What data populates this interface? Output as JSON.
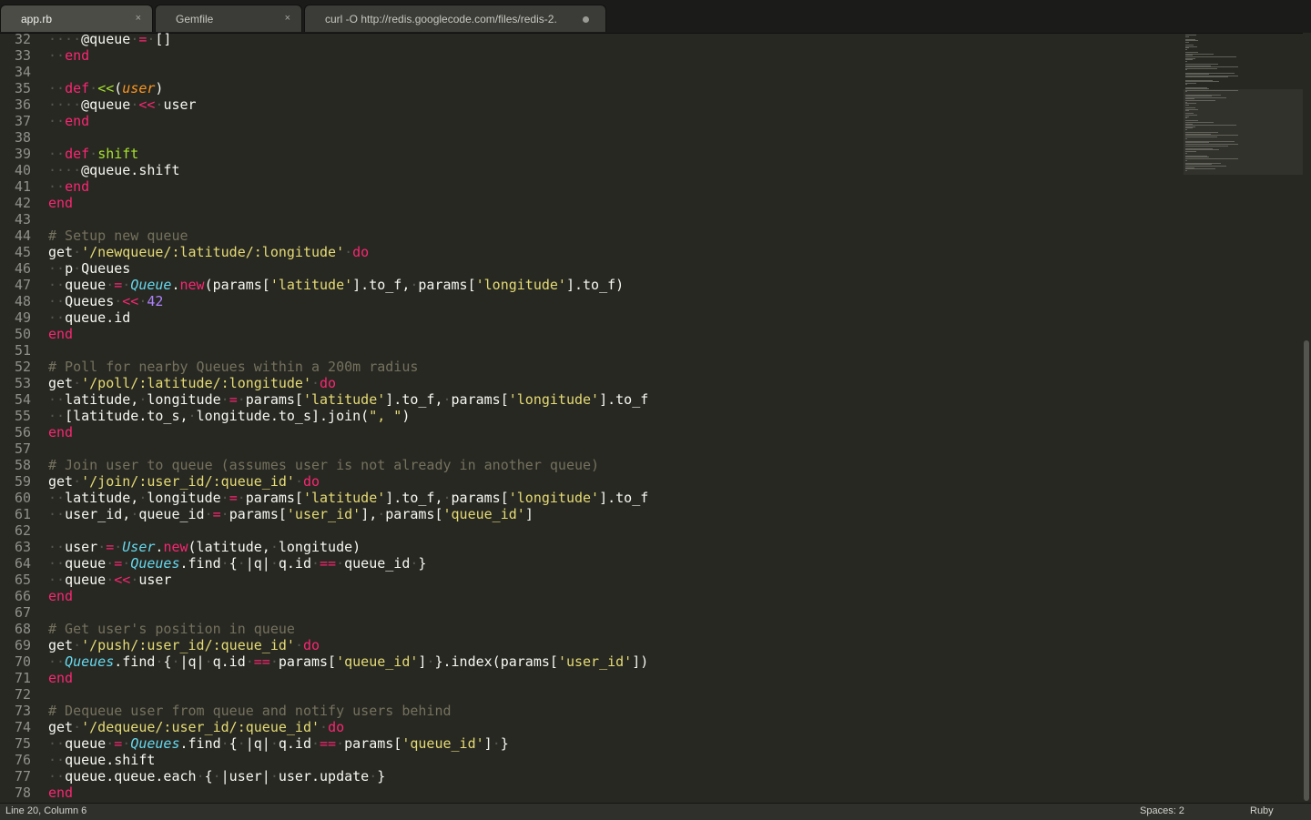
{
  "tabs": [
    {
      "label": "app.rb",
      "close": "×"
    },
    {
      "label": "Gemfile",
      "close": "×"
    },
    {
      "label": "curl -O http://redis.googlecode.com/files/redis-2."
    }
  ],
  "status": {
    "position": "Line 20, Column 6",
    "spaces": "Spaces: 2",
    "syntax": "Ruby"
  },
  "code_lines": [
    {
      "n": "32",
      "t": [
        [
          "w",
          "····"
        ],
        [
          "",
          "@queue"
        ],
        [
          "w",
          "·"
        ],
        [
          "k",
          "="
        ],
        [
          "w",
          "·"
        ],
        [
          "",
          "[]"
        ]
      ]
    },
    {
      "n": "33",
      "t": [
        [
          "w",
          "··"
        ],
        [
          "k",
          "end"
        ]
      ]
    },
    {
      "n": "34",
      "t": []
    },
    {
      "n": "35",
      "t": [
        [
          "w",
          "··"
        ],
        [
          "k",
          "def"
        ],
        [
          "w",
          "·"
        ],
        [
          "f",
          "<<"
        ],
        [
          "",
          "("
        ],
        [
          "p",
          "user"
        ],
        [
          "",
          ")"
        ]
      ]
    },
    {
      "n": "36",
      "t": [
        [
          "w",
          "····"
        ],
        [
          "",
          "@queue"
        ],
        [
          "w",
          "·"
        ],
        [
          "k",
          "<<"
        ],
        [
          "w",
          "·"
        ],
        [
          "",
          "user"
        ]
      ]
    },
    {
      "n": "37",
      "t": [
        [
          "w",
          "··"
        ],
        [
          "k",
          "end"
        ]
      ]
    },
    {
      "n": "38",
      "t": []
    },
    {
      "n": "39",
      "t": [
        [
          "w",
          "··"
        ],
        [
          "k",
          "def"
        ],
        [
          "w",
          "·"
        ],
        [
          "f",
          "shift"
        ]
      ]
    },
    {
      "n": "40",
      "t": [
        [
          "w",
          "····"
        ],
        [
          "",
          "@queue.shift"
        ]
      ]
    },
    {
      "n": "41",
      "t": [
        [
          "w",
          "··"
        ],
        [
          "k",
          "end"
        ]
      ]
    },
    {
      "n": "42",
      "t": [
        [
          "k",
          "end"
        ]
      ]
    },
    {
      "n": "43",
      "t": []
    },
    {
      "n": "44",
      "t": [
        [
          "c",
          "# Setup new queue"
        ]
      ]
    },
    {
      "n": "45",
      "t": [
        [
          "",
          "get"
        ],
        [
          "w",
          "·"
        ],
        [
          "s",
          "'/newqueue/:latitude/:longitude'"
        ],
        [
          "w",
          "·"
        ],
        [
          "k",
          "do"
        ]
      ]
    },
    {
      "n": "46",
      "t": [
        [
          "w",
          "··"
        ],
        [
          "",
          "p"
        ],
        [
          "w",
          "·"
        ],
        [
          "",
          "Queues"
        ]
      ]
    },
    {
      "n": "47",
      "t": [
        [
          "w",
          "··"
        ],
        [
          "",
          "queue"
        ],
        [
          "w",
          "·"
        ],
        [
          "k",
          "="
        ],
        [
          "w",
          "·"
        ],
        [
          "t",
          "Queue"
        ],
        [
          "",
          "."
        ],
        [
          "k",
          "new"
        ],
        [
          "",
          "(params["
        ],
        [
          "s",
          "'latitude'"
        ],
        [
          "",
          "].to_f,"
        ],
        [
          "w",
          "·"
        ],
        [
          "",
          "params["
        ],
        [
          "s",
          "'longitude'"
        ],
        [
          "",
          "].to_f)"
        ]
      ]
    },
    {
      "n": "48",
      "t": [
        [
          "w",
          "··"
        ],
        [
          "",
          "Queues"
        ],
        [
          "w",
          "·"
        ],
        [
          "k",
          "<<"
        ],
        [
          "w",
          "·"
        ],
        [
          "n",
          "42"
        ]
      ]
    },
    {
      "n": "49",
      "t": [
        [
          "w",
          "··"
        ],
        [
          "",
          "queue.id"
        ]
      ]
    },
    {
      "n": "50",
      "t": [
        [
          "k",
          "end"
        ]
      ]
    },
    {
      "n": "51",
      "t": []
    },
    {
      "n": "52",
      "t": [
        [
          "c",
          "# Poll for nearby Queues within a 200m radius"
        ]
      ]
    },
    {
      "n": "53",
      "t": [
        [
          "",
          "get"
        ],
        [
          "w",
          "·"
        ],
        [
          "s",
          "'/poll/:latitude/:longitude'"
        ],
        [
          "w",
          "·"
        ],
        [
          "k",
          "do"
        ]
      ]
    },
    {
      "n": "54",
      "t": [
        [
          "w",
          "··"
        ],
        [
          "",
          "latitude,"
        ],
        [
          "w",
          "·"
        ],
        [
          "",
          "longitude"
        ],
        [
          "w",
          "·"
        ],
        [
          "k",
          "="
        ],
        [
          "w",
          "·"
        ],
        [
          "",
          "params["
        ],
        [
          "s",
          "'latitude'"
        ],
        [
          "",
          "].to_f,"
        ],
        [
          "w",
          "·"
        ],
        [
          "",
          "params["
        ],
        [
          "s",
          "'longitude'"
        ],
        [
          "",
          "].to_f"
        ]
      ]
    },
    {
      "n": "55",
      "t": [
        [
          "w",
          "··"
        ],
        [
          "",
          "[latitude.to_s,"
        ],
        [
          "w",
          "·"
        ],
        [
          "",
          "longitude.to_s].join("
        ],
        [
          "s",
          "\", \""
        ],
        [
          "",
          ")"
        ]
      ]
    },
    {
      "n": "56",
      "t": [
        [
          "k",
          "end"
        ]
      ]
    },
    {
      "n": "57",
      "t": []
    },
    {
      "n": "58",
      "t": [
        [
          "c",
          "# Join user to queue (assumes user is not already in another queue)"
        ]
      ]
    },
    {
      "n": "59",
      "t": [
        [
          "",
          "get"
        ],
        [
          "w",
          "·"
        ],
        [
          "s",
          "'/join/:user_id/:queue_id'"
        ],
        [
          "w",
          "·"
        ],
        [
          "k",
          "do"
        ]
      ]
    },
    {
      "n": "60",
      "t": [
        [
          "w",
          "··"
        ],
        [
          "",
          "latitude,"
        ],
        [
          "w",
          "·"
        ],
        [
          "",
          "longitude"
        ],
        [
          "w",
          "·"
        ],
        [
          "k",
          "="
        ],
        [
          "w",
          "·"
        ],
        [
          "",
          "params["
        ],
        [
          "s",
          "'latitude'"
        ],
        [
          "",
          "].to_f,"
        ],
        [
          "w",
          "·"
        ],
        [
          "",
          "params["
        ],
        [
          "s",
          "'longitude'"
        ],
        [
          "",
          "].to_f"
        ]
      ]
    },
    {
      "n": "61",
      "t": [
        [
          "w",
          "··"
        ],
        [
          "",
          "user_id,"
        ],
        [
          "w",
          "·"
        ],
        [
          "",
          "queue_id"
        ],
        [
          "w",
          "·"
        ],
        [
          "k",
          "="
        ],
        [
          "w",
          "·"
        ],
        [
          "",
          "params["
        ],
        [
          "s",
          "'user_id'"
        ],
        [
          "",
          "],"
        ],
        [
          "w",
          "·"
        ],
        [
          "",
          "params["
        ],
        [
          "s",
          "'queue_id'"
        ],
        [
          "",
          "]"
        ]
      ]
    },
    {
      "n": "62",
      "t": []
    },
    {
      "n": "63",
      "t": [
        [
          "w",
          "··"
        ],
        [
          "",
          "user"
        ],
        [
          "w",
          "·"
        ],
        [
          "k",
          "="
        ],
        [
          "w",
          "·"
        ],
        [
          "t",
          "User"
        ],
        [
          "",
          "."
        ],
        [
          "k",
          "new"
        ],
        [
          "",
          "(latitude,"
        ],
        [
          "w",
          "·"
        ],
        [
          "",
          "longitude)"
        ]
      ]
    },
    {
      "n": "64",
      "t": [
        [
          "w",
          "··"
        ],
        [
          "",
          "queue"
        ],
        [
          "w",
          "·"
        ],
        [
          "k",
          "="
        ],
        [
          "w",
          "·"
        ],
        [
          "t",
          "Queues"
        ],
        [
          "",
          ".find"
        ],
        [
          "w",
          "·"
        ],
        [
          "",
          "{"
        ],
        [
          "w",
          "·"
        ],
        [
          "",
          "|q|"
        ],
        [
          "w",
          "·"
        ],
        [
          "",
          "q.id"
        ],
        [
          "w",
          "·"
        ],
        [
          "k",
          "=="
        ],
        [
          "w",
          "·"
        ],
        [
          "",
          "queue_id"
        ],
        [
          "w",
          "·"
        ],
        [
          "",
          "}"
        ]
      ]
    },
    {
      "n": "65",
      "t": [
        [
          "w",
          "··"
        ],
        [
          "",
          "queue"
        ],
        [
          "w",
          "·"
        ],
        [
          "k",
          "<<"
        ],
        [
          "w",
          "·"
        ],
        [
          "",
          "user"
        ]
      ]
    },
    {
      "n": "66",
      "t": [
        [
          "k",
          "end"
        ]
      ]
    },
    {
      "n": "67",
      "t": []
    },
    {
      "n": "68",
      "t": [
        [
          "c",
          "# Get user's position in queue"
        ]
      ]
    },
    {
      "n": "69",
      "t": [
        [
          "",
          "get"
        ],
        [
          "w",
          "·"
        ],
        [
          "s",
          "'/push/:user_id/:queue_id'"
        ],
        [
          "w",
          "·"
        ],
        [
          "k",
          "do"
        ]
      ]
    },
    {
      "n": "70",
      "t": [
        [
          "w",
          "··"
        ],
        [
          "t",
          "Queues"
        ],
        [
          "",
          ".find"
        ],
        [
          "w",
          "·"
        ],
        [
          "",
          "{"
        ],
        [
          "w",
          "·"
        ],
        [
          "",
          "|q|"
        ],
        [
          "w",
          "·"
        ],
        [
          "",
          "q.id"
        ],
        [
          "w",
          "·"
        ],
        [
          "k",
          "=="
        ],
        [
          "w",
          "·"
        ],
        [
          "",
          "params["
        ],
        [
          "s",
          "'queue_id'"
        ],
        [
          "",
          "]"
        ],
        [
          "w",
          "·"
        ],
        [
          "",
          "}.index(params["
        ],
        [
          "s",
          "'user_id'"
        ],
        [
          "",
          "])"
        ]
      ]
    },
    {
      "n": "71",
      "t": [
        [
          "k",
          "end"
        ]
      ]
    },
    {
      "n": "72",
      "t": []
    },
    {
      "n": "73",
      "t": [
        [
          "c",
          "# Dequeue user from queue and notify users behind"
        ]
      ]
    },
    {
      "n": "74",
      "t": [
        [
          "",
          "get"
        ],
        [
          "w",
          "·"
        ],
        [
          "s",
          "'/dequeue/:user_id/:queue_id'"
        ],
        [
          "w",
          "·"
        ],
        [
          "k",
          "do"
        ]
      ]
    },
    {
      "n": "75",
      "t": [
        [
          "w",
          "··"
        ],
        [
          "",
          "queue"
        ],
        [
          "w",
          "·"
        ],
        [
          "k",
          "="
        ],
        [
          "w",
          "·"
        ],
        [
          "t",
          "Queues"
        ],
        [
          "",
          ".find"
        ],
        [
          "w",
          "·"
        ],
        [
          "",
          "{"
        ],
        [
          "w",
          "·"
        ],
        [
          "",
          "|q|"
        ],
        [
          "w",
          "·"
        ],
        [
          "",
          "q.id"
        ],
        [
          "w",
          "·"
        ],
        [
          "k",
          "=="
        ],
        [
          "w",
          "·"
        ],
        [
          "",
          "params["
        ],
        [
          "s",
          "'queue_id'"
        ],
        [
          "",
          "]"
        ],
        [
          "w",
          "·"
        ],
        [
          "",
          "}"
        ]
      ]
    },
    {
      "n": "76",
      "t": [
        [
          "w",
          "··"
        ],
        [
          "",
          "queue.shift"
        ]
      ]
    },
    {
      "n": "77",
      "t": [
        [
          "w",
          "··"
        ],
        [
          "",
          "queue.queue.each"
        ],
        [
          "w",
          "·"
        ],
        [
          "",
          "{"
        ],
        [
          "w",
          "·"
        ],
        [
          "",
          "|user|"
        ],
        [
          "w",
          "·"
        ],
        [
          "",
          "user.update"
        ],
        [
          "w",
          "·"
        ],
        [
          "",
          "}"
        ]
      ]
    },
    {
      "n": "78",
      "t": [
        [
          "k",
          "end"
        ]
      ]
    }
  ]
}
